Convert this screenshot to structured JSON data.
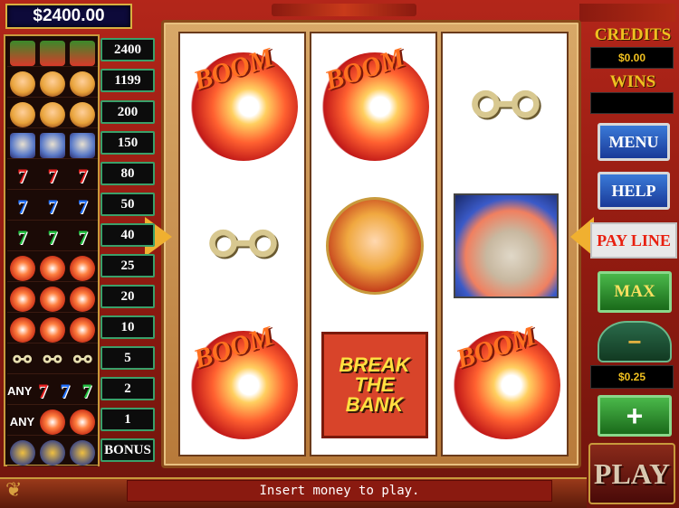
{
  "jackpot": "$2400.00",
  "paytable": [
    {
      "left": "",
      "icons": [
        "bbank",
        "bbank",
        "bbank"
      ],
      "payout": "2400"
    },
    {
      "left": "",
      "icons": [
        "gal",
        "gal",
        "gal"
      ],
      "payout": "1199"
    },
    {
      "left": "",
      "icons": [
        "gal",
        "gal",
        "gal"
      ],
      "payout": "200"
    },
    {
      "left": "",
      "icons": [
        "guy",
        "guy",
        "guy"
      ],
      "payout": "150"
    },
    {
      "left": "",
      "icons": [
        "7r",
        "7r",
        "7r"
      ],
      "payout": "80"
    },
    {
      "left": "",
      "icons": [
        "7b",
        "7b",
        "7b"
      ],
      "payout": "50"
    },
    {
      "left": "",
      "icons": [
        "7g",
        "7g",
        "7g"
      ],
      "payout": "40"
    },
    {
      "left": "",
      "icons": [
        "dyn",
        "dyn",
        "dyn"
      ],
      "payout": "25"
    },
    {
      "left": "",
      "icons": [
        "dyn",
        "dyn",
        "dyn"
      ],
      "payout": "20"
    },
    {
      "left": "",
      "icons": [
        "dyn",
        "dyn",
        "dyn"
      ],
      "payout": "10"
    },
    {
      "left": "",
      "icons": [
        "cuff",
        "cuff",
        "cuff"
      ],
      "payout": "5"
    },
    {
      "left": "ANY",
      "icons": [
        "7r",
        "7b",
        "7g"
      ],
      "payout": "2"
    },
    {
      "left": "ANY",
      "icons": [
        "dyn",
        "dyn"
      ],
      "payout": "1"
    },
    {
      "left": "",
      "icons": [
        "badge",
        "badge",
        "badge"
      ],
      "payout": "BONUS"
    }
  ],
  "reels": [
    [
      "boom",
      "handcuffs",
      "boom"
    ],
    [
      "boom",
      "showgirl",
      "break-the-bank"
    ],
    [
      "handcuffs",
      "gangster",
      "boom"
    ]
  ],
  "symbols": {
    "boom_text": "BOOM",
    "break_the_bank_line1": "BREAK",
    "break_the_bank_line2": "THE BANK",
    "cuffs_glyph": "⚯",
    "seven_glyph": "7"
  },
  "credits": {
    "label": "CREDITS",
    "value": "$0.00"
  },
  "wins": {
    "label": "WINS",
    "value": ""
  },
  "menu_label": "MENU",
  "help_label": "HELP",
  "payline_label": "PAY LINE",
  "max_label": "MAX",
  "minus_label": "−",
  "bet_value": "$0.25",
  "plus_label": "+",
  "play_label": "PLAY",
  "status_message": "Insert money to play.",
  "colors": {
    "frame_gold": "#c89a3c",
    "status_bg": "#8a1a10",
    "credits_gold": "#f0c020"
  }
}
